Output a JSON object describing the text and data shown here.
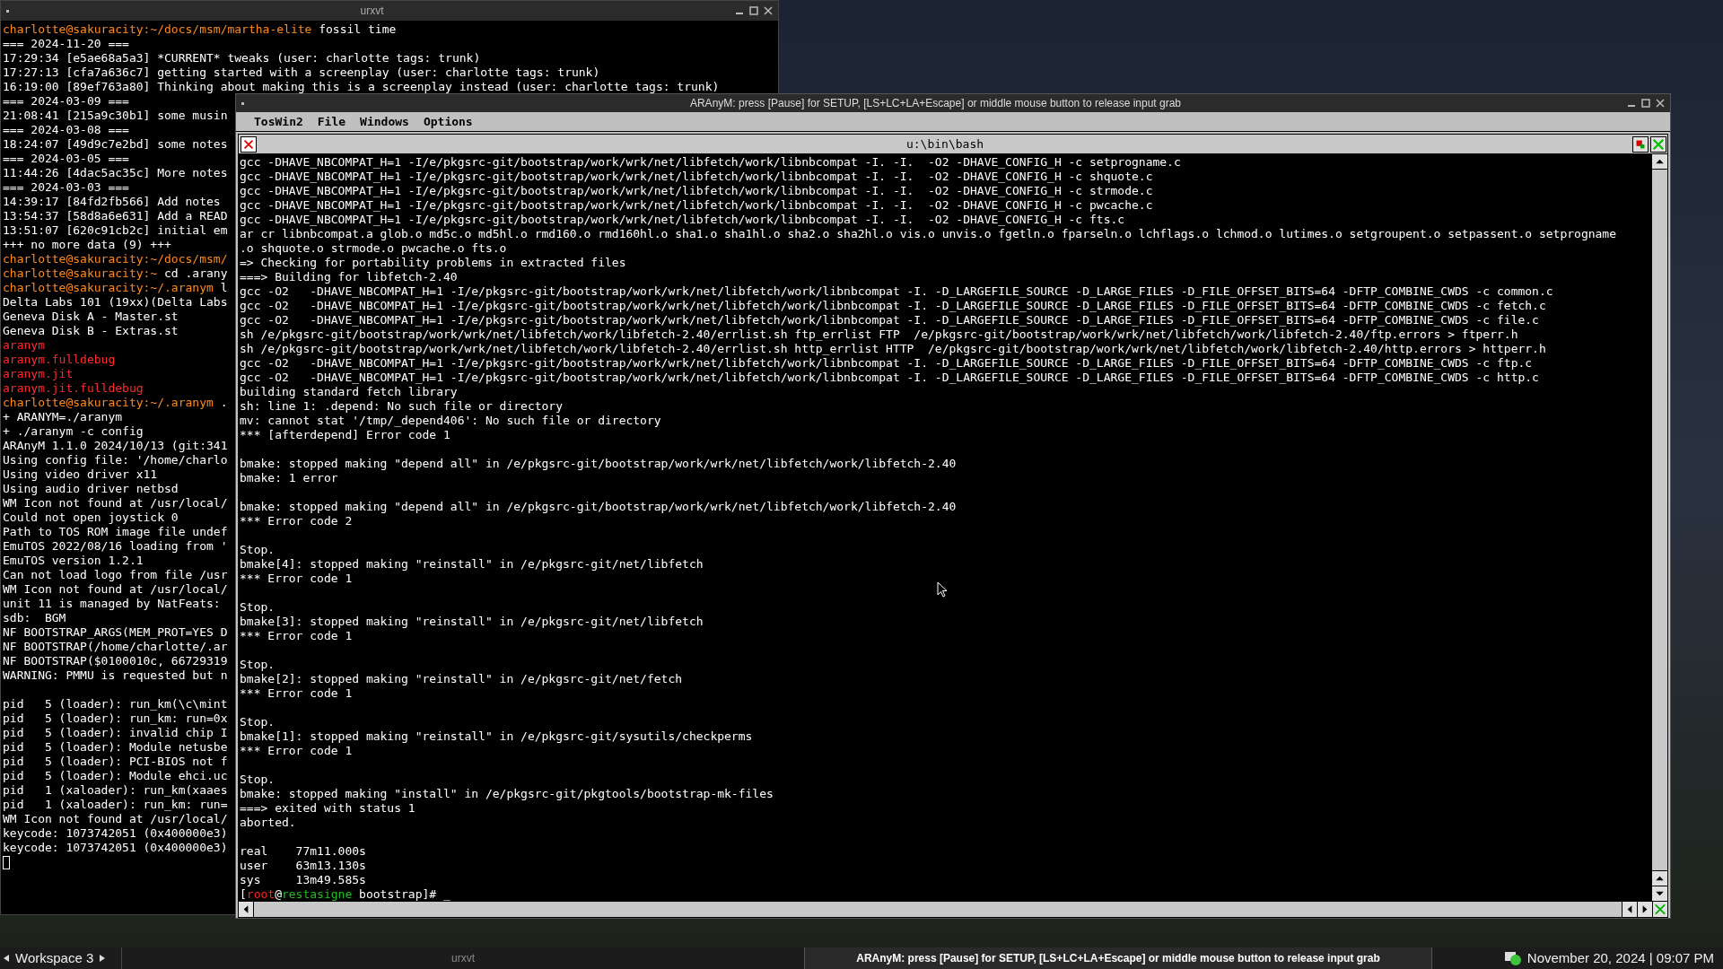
{
  "terminal_window": {
    "title": "urxvt",
    "lines": [
      {
        "kind": "prompt",
        "prompt": "charlotte@sakuracity:~/docs/msm/martha-elite",
        "command": " fossil time"
      },
      {
        "kind": "text",
        "text": "=== 2024-11-20 ==="
      },
      {
        "kind": "text",
        "text": "17:29:34 [e5ae68a5a3] *CURRENT* tweaks (user: charlotte tags: trunk)"
      },
      {
        "kind": "text",
        "text": "17:27:13 [cfa7a636c7] getting started with a screenplay (user: charlotte tags: trunk)"
      },
      {
        "kind": "text",
        "text": "16:19:00 [89ef763a80] Thinking about making this is a screenplay instead (user: charlotte tags: trunk)"
      },
      {
        "kind": "text",
        "text": "=== 2024-03-09 ==="
      },
      {
        "kind": "text",
        "text": "21:08:41 [215a9c30b1] some musin"
      },
      {
        "kind": "text",
        "text": "=== 2024-03-08 ==="
      },
      {
        "kind": "text",
        "text": "18:24:07 [49d9c7e2bd] some notes"
      },
      {
        "kind": "text",
        "text": "=== 2024-03-05 ==="
      },
      {
        "kind": "text",
        "text": "11:44:26 [4dac5ac35c] More notes"
      },
      {
        "kind": "text",
        "text": "=== 2024-03-03 ==="
      },
      {
        "kind": "text",
        "text": "14:39:17 [84fd2fb566] Add notes"
      },
      {
        "kind": "text",
        "text": "13:54:37 [58d8a6e631] Add a READ"
      },
      {
        "kind": "text",
        "text": "13:51:07 [620c91cb2c] initial em"
      },
      {
        "kind": "text",
        "text": "+++ no more data (9) +++"
      },
      {
        "kind": "prompt",
        "prompt": "charlotte@sakuracity:~/docs/msm/"
      },
      {
        "kind": "prompt",
        "prompt": "charlotte@sakuracity:~",
        "command": " cd .arany"
      },
      {
        "kind": "prompt",
        "prompt": "charlotte@sakuracity:~/.aranym",
        "command": " l"
      },
      {
        "kind": "text",
        "text": "Delta Labs 101 (19xx)(Delta Labs"
      },
      {
        "kind": "text",
        "text": "Geneva Disk A - Master.st"
      },
      {
        "kind": "text",
        "text": "Geneva Disk B - Extras.st"
      },
      {
        "kind": "file",
        "text": "aranym"
      },
      {
        "kind": "file",
        "text": "aranym.fulldebug"
      },
      {
        "kind": "file",
        "text": "aranym.jit"
      },
      {
        "kind": "file",
        "text": "aranym.jit.fulldebug"
      },
      {
        "kind": "prompt",
        "prompt": "charlotte@sakuracity:~/.aranym",
        "command": " ."
      },
      {
        "kind": "text",
        "text": "+ ARANYM=./aranym"
      },
      {
        "kind": "text",
        "text": "+ ./aranym -c config"
      },
      {
        "kind": "text",
        "text": "ARAnyM 1.1.0 2024/10/13 (git:341"
      },
      {
        "kind": "text",
        "text": "Using config file: '/home/charlo"
      },
      {
        "kind": "text",
        "text": "Using video driver x11"
      },
      {
        "kind": "text",
        "text": "Using audio driver netbsd"
      },
      {
        "kind": "text",
        "text": "WM Icon not found at /usr/local/"
      },
      {
        "kind": "text",
        "text": "Could not open joystick 0"
      },
      {
        "kind": "text",
        "text": "Path to TOS ROM image file undef"
      },
      {
        "kind": "text",
        "text": "EmuTOS 2022/08/16 loading from '"
      },
      {
        "kind": "text",
        "text": "EmuTOS version 1.2.1"
      },
      {
        "kind": "text",
        "text": "Can not load logo from file /usr"
      },
      {
        "kind": "text",
        "text": "WM Icon not found at /usr/local/"
      },
      {
        "kind": "text",
        "text": "unit 11 is managed by NatFeats:"
      },
      {
        "kind": "text",
        "text": "sdb:  BGM"
      },
      {
        "kind": "text",
        "text": "NF BOOTSTRAP_ARGS(MEM_PROT=YES D"
      },
      {
        "kind": "text",
        "text": "NF BOOTSTRAP(/home/charlotte/.ar"
      },
      {
        "kind": "text",
        "text": "NF BOOTSTRAP($0100010c, 66729319"
      },
      {
        "kind": "text",
        "text": "WARNING: PMMU is requested but n"
      },
      {
        "kind": "blank"
      },
      {
        "kind": "text",
        "text": "pid   5 (loader): run_km(\\c\\mint"
      },
      {
        "kind": "text",
        "text": "pid   5 (loader): run_km: run=0x"
      },
      {
        "kind": "text",
        "text": "pid   5 (loader): invalid chip I"
      },
      {
        "kind": "text",
        "text": "pid   5 (loader): Module netusbe"
      },
      {
        "kind": "text",
        "text": "pid   5 (loader): PCI-BIOS not f"
      },
      {
        "kind": "text",
        "text": "pid   5 (loader): Module ehci.uc"
      },
      {
        "kind": "text",
        "text": "pid   1 (xaloader): run_km(xaaes"
      },
      {
        "kind": "text",
        "text": "pid   1 (xaloader): run_km: run="
      },
      {
        "kind": "text",
        "text": "WM Icon not found at /usr/local/"
      },
      {
        "kind": "text",
        "text": "keycode: 1073742051 (0x400000e3)"
      },
      {
        "kind": "text",
        "text": "keycode: 1073742051 (0x400000e3)"
      },
      {
        "kind": "cursor"
      }
    ]
  },
  "emulator_window": {
    "title": "ARAnyM: press [Pause] for SETUP, [LS+LC+LA+Escape] or middle mouse button to release input grab",
    "menu": [
      "TosWin2",
      "File",
      "Windows",
      "Options"
    ],
    "terminal": {
      "title": "u:\\bin\\bash",
      "lines": [
        {
          "kind": "text",
          "text": "gcc -DHAVE_NBCOMPAT_H=1 -I/e/pkgsrc-git/bootstrap/work/wrk/net/libfetch/work/libnbcompat -I. -I.  -O2 -DHAVE_CONFIG_H -c setprogname.c"
        },
        {
          "kind": "text",
          "text": "gcc -DHAVE_NBCOMPAT_H=1 -I/e/pkgsrc-git/bootstrap/work/wrk/net/libfetch/work/libnbcompat -I. -I.  -O2 -DHAVE_CONFIG_H -c shquote.c"
        },
        {
          "kind": "text",
          "text": "gcc -DHAVE_NBCOMPAT_H=1 -I/e/pkgsrc-git/bootstrap/work/wrk/net/libfetch/work/libnbcompat -I. -I.  -O2 -DHAVE_CONFIG_H -c strmode.c"
        },
        {
          "kind": "text",
          "text": "gcc -DHAVE_NBCOMPAT_H=1 -I/e/pkgsrc-git/bootstrap/work/wrk/net/libfetch/work/libnbcompat -I. -I.  -O2 -DHAVE_CONFIG_H -c pwcache.c"
        },
        {
          "kind": "text",
          "text": "gcc -DHAVE_NBCOMPAT_H=1 -I/e/pkgsrc-git/bootstrap/work/wrk/net/libfetch/work/libnbcompat -I. -I.  -O2 -DHAVE_CONFIG_H -c fts.c"
        },
        {
          "kind": "text",
          "text": "ar cr libnbcompat.a glob.o md5c.o md5hl.o rmd160.o rmd160hl.o sha1.o sha1hl.o sha2.o sha2hl.o vis.o unvis.o fgetln.o fparseln.o lchflags.o lchmod.o lutimes.o setgroupent.o setpassent.o setprogname"
        },
        {
          "kind": "text",
          "text": ".o shquote.o strmode.o pwcache.o fts.o"
        },
        {
          "kind": "text",
          "text": "=> Checking for portability problems in extracted files"
        },
        {
          "kind": "text",
          "text": "===> Building for libfetch-2.40"
        },
        {
          "kind": "text",
          "text": "gcc -O2   -DHAVE_NBCOMPAT_H=1 -I/e/pkgsrc-git/bootstrap/work/wrk/net/libfetch/work/libnbcompat -I. -D_LARGEFILE_SOURCE -D_LARGE_FILES -D_FILE_OFFSET_BITS=64 -DFTP_COMBINE_CWDS -c common.c"
        },
        {
          "kind": "text",
          "text": "gcc -O2   -DHAVE_NBCOMPAT_H=1 -I/e/pkgsrc-git/bootstrap/work/wrk/net/libfetch/work/libnbcompat -I. -D_LARGEFILE_SOURCE -D_LARGE_FILES -D_FILE_OFFSET_BITS=64 -DFTP_COMBINE_CWDS -c fetch.c"
        },
        {
          "kind": "text",
          "text": "gcc -O2   -DHAVE_NBCOMPAT_H=1 -I/e/pkgsrc-git/bootstrap/work/wrk/net/libfetch/work/libnbcompat -I. -D_LARGEFILE_SOURCE -D_LARGE_FILES -D_FILE_OFFSET_BITS=64 -DFTP_COMBINE_CWDS -c file.c"
        },
        {
          "kind": "text",
          "text": "sh /e/pkgsrc-git/bootstrap/work/wrk/net/libfetch/work/libfetch-2.40/errlist.sh ftp_errlist FTP  /e/pkgsrc-git/bootstrap/work/wrk/net/libfetch/work/libfetch-2.40/ftp.errors > ftperr.h"
        },
        {
          "kind": "text",
          "text": "sh /e/pkgsrc-git/bootstrap/work/wrk/net/libfetch/work/libfetch-2.40/errlist.sh http_errlist HTTP  /e/pkgsrc-git/bootstrap/work/wrk/net/libfetch/work/libfetch-2.40/http.errors > httperr.h"
        },
        {
          "kind": "text",
          "text": "gcc -O2   -DHAVE_NBCOMPAT_H=1 -I/e/pkgsrc-git/bootstrap/work/wrk/net/libfetch/work/libnbcompat -I. -D_LARGEFILE_SOURCE -D_LARGE_FILES -D_FILE_OFFSET_BITS=64 -DFTP_COMBINE_CWDS -c ftp.c"
        },
        {
          "kind": "text",
          "text": "gcc -O2   -DHAVE_NBCOMPAT_H=1 -I/e/pkgsrc-git/bootstrap/work/wrk/net/libfetch/work/libnbcompat -I. -D_LARGEFILE_SOURCE -D_LARGE_FILES -D_FILE_OFFSET_BITS=64 -DFTP_COMBINE_CWDS -c http.c"
        },
        {
          "kind": "text",
          "text": "building standard fetch library"
        },
        {
          "kind": "text",
          "text": "sh: line 1: .depend: No such file or directory"
        },
        {
          "kind": "text",
          "text": "mv: cannot stat '/tmp/_depend406': No such file or directory"
        },
        {
          "kind": "text",
          "text": "*** [afterdepend] Error code 1"
        },
        {
          "kind": "blank"
        },
        {
          "kind": "text",
          "text": "bmake: stopped making \"depend all\" in /e/pkgsrc-git/bootstrap/work/wrk/net/libfetch/work/libfetch-2.40"
        },
        {
          "kind": "text",
          "text": "bmake: 1 error"
        },
        {
          "kind": "blank"
        },
        {
          "kind": "text",
          "text": "bmake: stopped making \"depend all\" in /e/pkgsrc-git/bootstrap/work/wrk/net/libfetch/work/libfetch-2.40"
        },
        {
          "kind": "text",
          "text": "*** Error code 2"
        },
        {
          "kind": "blank"
        },
        {
          "kind": "text",
          "text": "Stop."
        },
        {
          "kind": "text",
          "text": "bmake[4]: stopped making \"reinstall\" in /e/pkgsrc-git/net/libfetch"
        },
        {
          "kind": "text",
          "text": "*** Error code 1"
        },
        {
          "kind": "blank"
        },
        {
          "kind": "text",
          "text": "Stop."
        },
        {
          "kind": "text",
          "text": "bmake[3]: stopped making \"reinstall\" in /e/pkgsrc-git/net/libfetch"
        },
        {
          "kind": "text",
          "text": "*** Error code 1"
        },
        {
          "kind": "blank"
        },
        {
          "kind": "text",
          "text": "Stop."
        },
        {
          "kind": "text",
          "text": "bmake[2]: stopped making \"reinstall\" in /e/pkgsrc-git/net/fetch"
        },
        {
          "kind": "text",
          "text": "*** Error code 1"
        },
        {
          "kind": "blank"
        },
        {
          "kind": "text",
          "text": "Stop."
        },
        {
          "kind": "text",
          "text": "bmake[1]: stopped making \"reinstall\" in /e/pkgsrc-git/sysutils/checkperms"
        },
        {
          "kind": "text",
          "text": "*** Error code 1"
        },
        {
          "kind": "blank"
        },
        {
          "kind": "text",
          "text": "Stop."
        },
        {
          "kind": "text",
          "text": "bmake: stopped making \"install\" in /e/pkgsrc-git/pkgtools/bootstrap-mk-files"
        },
        {
          "kind": "text",
          "text": "===> exited with status 1"
        },
        {
          "kind": "text",
          "text": "aborted."
        },
        {
          "kind": "blank"
        },
        {
          "kind": "text",
          "text": "real    77m11.000s"
        },
        {
          "kind": "text",
          "text": "user    63m13.130s"
        },
        {
          "kind": "text",
          "text": "sys     13m49.585s"
        }
      ],
      "prompt": [
        {
          "text": "["
        },
        {
          "text": "root",
          "color": "#ff2020"
        },
        {
          "text": "@"
        },
        {
          "text": "restasigne",
          "color": "#20c020"
        },
        {
          "text": " bootstrap]# _"
        }
      ]
    }
  },
  "taskbar": {
    "workspace": "Workspace 3",
    "tasks": [
      {
        "label": "urxvt",
        "selected": false
      },
      {
        "label": "ARAnyM: press [Pause] for SETUP, [LS+LC+LA+Escape] or middle mouse button to release input grab",
        "selected": true
      }
    ],
    "clock": "November 20, 2024 | 09:07 PM"
  }
}
